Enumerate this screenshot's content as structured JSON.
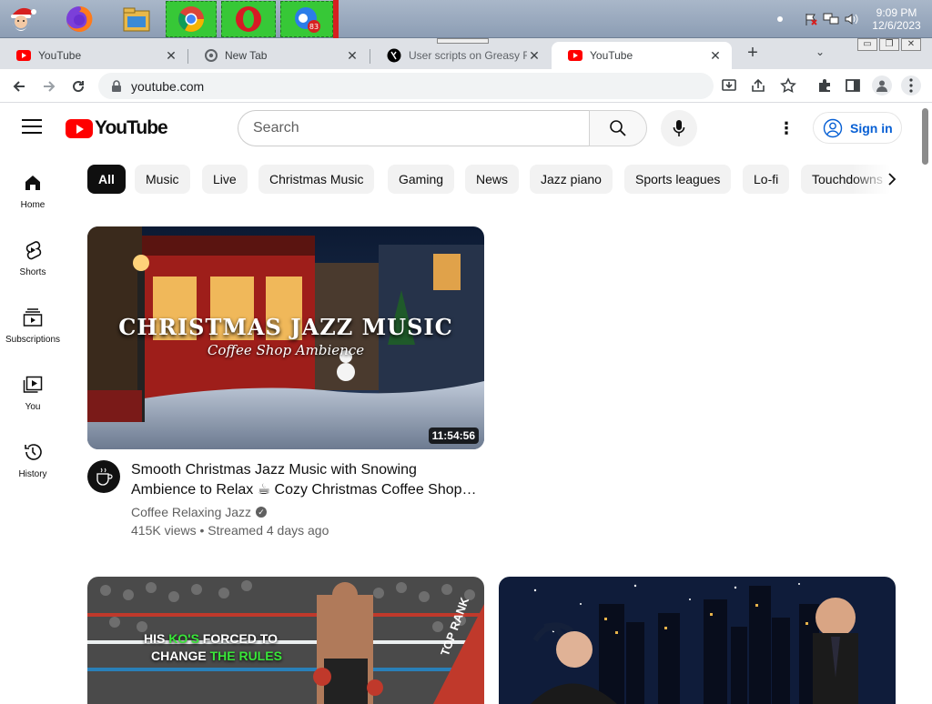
{
  "taskbar": {
    "badge_count": "83",
    "clock_time": "9:09 PM",
    "clock_date": "12/6/2023"
  },
  "tabs": [
    {
      "label": "YouTube",
      "icon": "youtube-favicon"
    },
    {
      "label": "New Tab",
      "icon": "chrome-favicon"
    },
    {
      "label": "User scripts on Greasy Fork",
      "icon": "greasyfork-favicon"
    },
    {
      "label": "YouTube",
      "icon": "youtube-favicon",
      "active": true
    }
  ],
  "address_bar": {
    "url": "youtube.com"
  },
  "youtube": {
    "logo_text": "YouTube",
    "search_placeholder": "Search",
    "signin_label": "Sign in",
    "guide": [
      {
        "label": "Home",
        "icon": "home-icon"
      },
      {
        "label": "Shorts",
        "icon": "shorts-icon"
      },
      {
        "label": "Subscriptions",
        "icon": "subscriptions-icon"
      },
      {
        "label": "You",
        "icon": "you-icon"
      },
      {
        "label": "History",
        "icon": "history-icon"
      }
    ],
    "chips": [
      "All",
      "Music",
      "Live",
      "Christmas Music",
      "Gaming",
      "News",
      "Jazz piano",
      "Sports leagues",
      "Lo-fi",
      "Touchdowns"
    ],
    "videos": [
      {
        "thumb_title": "CHRISTMAS JAZZ MUSIC",
        "thumb_subtitle": "Coffee Shop Ambience",
        "duration": "11:54:56",
        "title_line1": "Smooth Christmas Jazz Music with Snowing",
        "title_line2": "Ambience to Relax ☕ Cozy Christmas Coffee Shop Ambience",
        "channel": "Coffee Relaxing Jazz",
        "views": "415K views",
        "age": "Streamed 4 days ago",
        "avatar_text": "Coffee Music"
      },
      {
        "thumb_line1": "HIS KO'S FORCED TO",
        "thumb_line2": "CHANGE THE RULES",
        "thumb_highlight1": "KO'S",
        "thumb_highlight2": "THE RULES",
        "corner_text": "TOP RANK"
      },
      {}
    ]
  },
  "colors": {
    "youtube_red": "#ff0000",
    "link_blue": "#065fd4",
    "chip_selected": "#0f0f0f",
    "chip_bg": "#f2f2f2"
  }
}
